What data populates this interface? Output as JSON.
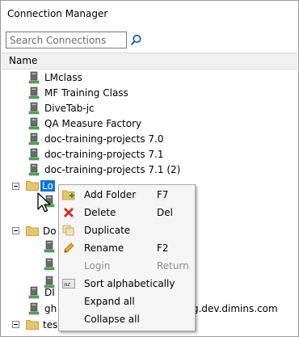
{
  "window": {
    "title": "Connection Manager"
  },
  "search": {
    "placeholder": "Search Connections"
  },
  "columns": {
    "name": "Name"
  },
  "tree": {
    "connections": [
      "LMclass",
      "MF Training Class",
      "DiveTab-jc",
      "QA Measure Factory",
      "doc-training-projects 7.0",
      "doc-training-projects 7.1",
      "doc-training-projects 7.1 (2)"
    ],
    "selected_folder": "Lo",
    "folder2": "Do",
    "item_dl": "DI",
    "item_gh_prefix": "gh",
    "item_gh_suffix": "g.dev.dimins.com",
    "folder3": "tes"
  },
  "context_menu": {
    "items": [
      {
        "label": "Add Folder",
        "shortcut": "F7",
        "icon": "add-folder-icon",
        "disabled": false
      },
      {
        "label": "Delete",
        "shortcut": "Del",
        "icon": "delete-icon",
        "disabled": false
      },
      {
        "label": "Duplicate",
        "shortcut": "",
        "icon": "duplicate-icon",
        "disabled": false
      },
      {
        "label": "Rename",
        "shortcut": "F2",
        "icon": "rename-pencil-icon",
        "disabled": false
      },
      {
        "label": "Login",
        "shortcut": "Return",
        "icon": "",
        "disabled": true
      },
      {
        "label": "Sort alphabetically",
        "shortcut": "",
        "icon": "sort-az-icon",
        "disabled": false
      },
      {
        "label": "Expand all",
        "shortcut": "",
        "icon": "",
        "disabled": false
      },
      {
        "label": "Collapse all",
        "shortcut": "",
        "icon": "",
        "disabled": false
      }
    ]
  },
  "colors": {
    "selection": "#0b74d6",
    "folder": "#e8c46a",
    "menu_bg": "#f5f5f5",
    "search_icon": "#1a5fb4"
  }
}
